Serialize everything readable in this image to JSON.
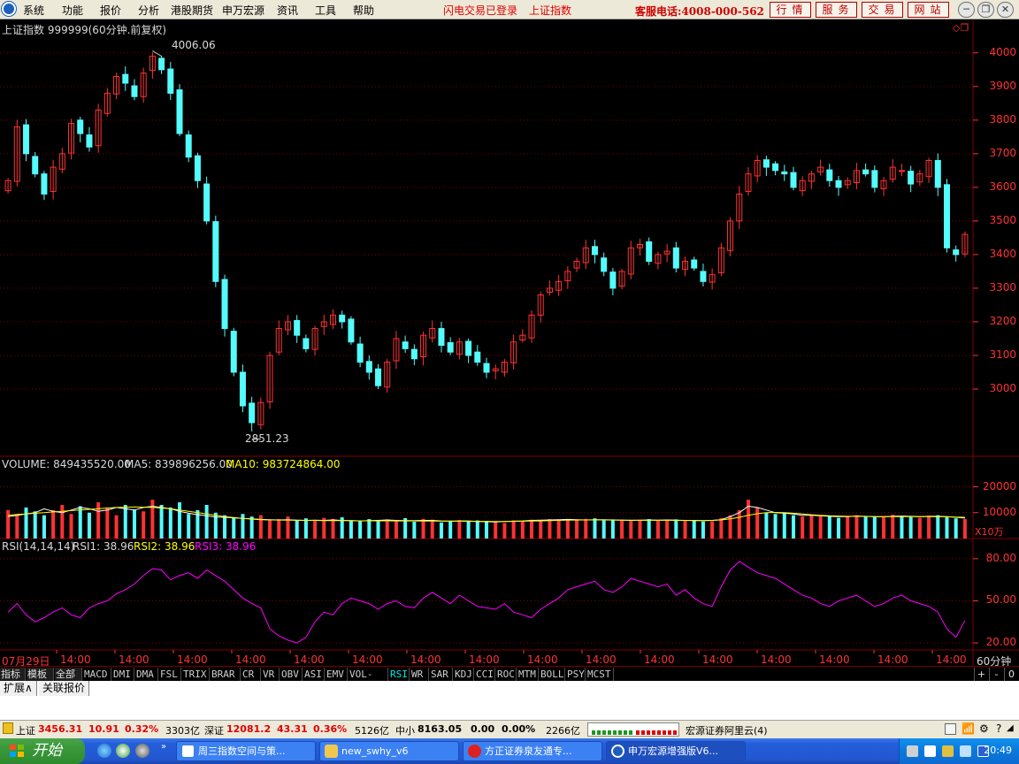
{
  "menubar": {
    "items": [
      "系统",
      "功能",
      "报价",
      "分析",
      "港股期货",
      "申万宏源",
      "资讯",
      "工具",
      "帮助"
    ],
    "notice_login": "闪电交易已登录",
    "notice_index": "上证指数",
    "service_phone": "客服电话:4008-000-562",
    "buttons": [
      "行情",
      "服务",
      "交易",
      "网站"
    ],
    "window_controls": [
      "minimize-icon",
      "restore-icon",
      "close-icon"
    ]
  },
  "chart": {
    "header": "上证指数 999999(60分钟.前复权)",
    "max_label": "4006.06",
    "min_label": "2851.23",
    "volume_header": {
      "volume": "VOLUME: 849435520.00",
      "ma5": "MA5: 839896256.00",
      "ma10": "MA10: 983724864.00"
    },
    "volume_unit": "X10万",
    "rsi_header": {
      "name": "RSI(14,14,14)",
      "rsi1": "RSI1: 38.96",
      "rsi2": "RSI2: 38.96",
      "rsi3": "RSI3: 38.96"
    },
    "date_start": "07月29日",
    "time_label": "14:00",
    "period": "60分钟",
    "colors": {
      "up": "#ff3232",
      "down": "#54fcfc",
      "ma5": "#ffffff",
      "ma10": "#ffff00",
      "rsi": "#ff00ff",
      "grid": "#800000"
    }
  },
  "chart_data": [
    {
      "type": "candlestick",
      "title": "上证指数 999999(60分钟.前复权)",
      "ylim": [
        2800,
        4060
      ],
      "yticks": [
        3000,
        3100,
        3200,
        3300,
        3400,
        3500,
        3600,
        3700,
        3800,
        3900,
        4000
      ],
      "annotations": [
        {
          "label": "4006.06",
          "value": 4006.06
        },
        {
          "label": "2851.23",
          "value": 2851.23
        }
      ],
      "series": [
        {
          "name": "close",
          "values": [
            3620,
            3780,
            3700,
            3640,
            3580,
            3660,
            3700,
            3790,
            3760,
            3720,
            3830,
            3880,
            3930,
            3910,
            3870,
            3940,
            3990,
            3950,
            3880,
            3760,
            3690,
            3620,
            3500,
            3320,
            3180,
            3050,
            2950,
            2900,
            2960,
            3100,
            3180,
            3200,
            3160,
            3120,
            3180,
            3200,
            3220,
            3200,
            3140,
            3080,
            3050,
            3010,
            3080,
            3150,
            3120,
            3090,
            3160,
            3180,
            3130,
            3110,
            3140,
            3100,
            3080,
            3050,
            3060,
            3080,
            3140,
            3160,
            3220,
            3280,
            3300,
            3320,
            3350,
            3380,
            3420,
            3400,
            3350,
            3300,
            3350,
            3420,
            3430,
            3380,
            3400,
            3410,
            3360,
            3380,
            3360,
            3320,
            3340,
            3420,
            3500,
            3580,
            3640,
            3680,
            3660,
            3650,
            3640,
            3600,
            3620,
            3640,
            3660,
            3620,
            3600,
            3620,
            3650,
            3640,
            3600,
            3620,
            3660,
            3650,
            3610,
            3640,
            3680,
            3600,
            3420,
            3400,
            3460
          ]
        }
      ]
    },
    {
      "type": "bar",
      "title": "VOLUME",
      "ylabel": "X10万",
      "yticks": [
        10000,
        20000
      ],
      "series": [
        {
          "name": "VOLUME",
          "values": [
            11000,
            9000,
            12000,
            10500,
            9000,
            11000,
            13000,
            9500,
            12500,
            10000,
            14000,
            12000,
            9000,
            13000,
            11000,
            10500,
            15000,
            13000,
            12000,
            14000,
            9500,
            11000,
            13000,
            10000,
            9000,
            8000,
            9500,
            8500,
            9000,
            7000,
            7500,
            8500,
            7000,
            7800,
            7200,
            8000,
            7600,
            8200,
            7000,
            6800,
            7500,
            7200,
            7400,
            7000,
            7900,
            6500,
            7600,
            7300,
            6200,
            6900,
            7100,
            6600,
            7000,
            6800,
            6400,
            6000,
            7000,
            6600,
            7300,
            6900,
            7500,
            7000,
            7200,
            7300,
            7600,
            7800,
            7000,
            7400,
            7300,
            7100,
            7200,
            7500,
            7000,
            7300,
            7400,
            7100,
            7000,
            6600,
            6700,
            7900,
            9000,
            11000,
            15000,
            12000,
            10000,
            9500,
            9800,
            9000,
            8500,
            9000,
            8600,
            8800,
            8000,
            8500,
            9000,
            8700,
            8400,
            8200,
            9200,
            8600,
            8300,
            8000,
            8800,
            9000,
            8200,
            7800,
            7500
          ]
        },
        {
          "name": "MA5",
          "values": [
            8500,
            9000,
            9500,
            10000,
            11500,
            10500,
            10000,
            11000,
            12000,
            11500,
            10500,
            11000,
            12000,
            11500,
            11000,
            12000,
            12500,
            12000,
            11500,
            10500,
            9800,
            9200,
            8800,
            8300,
            8200,
            8000,
            7800,
            7600,
            7400,
            7300,
            7200,
            7300,
            7100,
            7000,
            7100,
            7000,
            7200,
            7000,
            6900,
            6800,
            6900,
            7000,
            7200,
            7000,
            6900,
            6900,
            7000,
            7000,
            6800,
            6700,
            6800,
            6800,
            6600,
            6500,
            6400,
            6600,
            6700,
            6800,
            7000,
            7100,
            7200,
            7300,
            7400,
            7300,
            7200,
            7300,
            7300,
            7200,
            7100,
            7000,
            7100,
            7200,
            7100,
            7200,
            7100,
            7000,
            6900,
            6900,
            7000,
            7300,
            8500,
            10000,
            12500,
            12000,
            11000,
            10000,
            9800,
            9500,
            9000,
            9000,
            8800,
            8600,
            8500,
            8500,
            8700,
            8600,
            8500,
            8400,
            8600,
            8700,
            8600,
            8500,
            8600,
            8600,
            8500,
            8200,
            7900
          ]
        },
        {
          "name": "MA10",
          "values": [
            9000,
            9300,
            9500,
            9800,
            10000,
            10300,
            10500,
            10800,
            11000,
            11300,
            11500,
            11800,
            12000,
            12100,
            12200,
            12100,
            12000,
            11800,
            11500,
            11000,
            10500,
            10000,
            9500,
            9000,
            8500,
            8100,
            7800,
            7500,
            7300,
            7200,
            7150,
            7100,
            7050,
            7000,
            7000,
            6950,
            6950,
            6900,
            6900,
            6850,
            6850,
            6850,
            6850,
            6800,
            6800,
            6800,
            6750,
            6750,
            6700,
            6700,
            6700,
            6650,
            6650,
            6650,
            6600,
            6600,
            6650,
            6700,
            6750,
            6800,
            6900,
            7000,
            7100,
            7150,
            7200,
            7200,
            7200,
            7150,
            7100,
            7100,
            7050,
            7050,
            7050,
            7050,
            7000,
            7000,
            7000,
            6950,
            7000,
            7200,
            7600,
            8200,
            9000,
            9600,
            10000,
            10100,
            10000,
            9800,
            9500,
            9200,
            9000,
            8800,
            8700,
            8600,
            8600,
            8550,
            8500,
            8500,
            8500,
            8500,
            8500,
            8450,
            8450,
            8400,
            8400,
            8300,
            8200
          ]
        }
      ]
    },
    {
      "type": "line",
      "title": "RSI(14,14,14)",
      "ylim": [
        15,
        90
      ],
      "yticks": [
        20,
        50,
        80
      ],
      "series": [
        {
          "name": "RSI1",
          "values": [
            42,
            48,
            40,
            35,
            38,
            42,
            45,
            40,
            38,
            45,
            48,
            50,
            55,
            58,
            62,
            68,
            73,
            72,
            65,
            68,
            70,
            66,
            72,
            68,
            64,
            58,
            52,
            48,
            45,
            30,
            25,
            22,
            20,
            24,
            35,
            42,
            40,
            48,
            52,
            50,
            48,
            44,
            48,
            50,
            46,
            45,
            52,
            56,
            52,
            48,
            54,
            50,
            46,
            45,
            44,
            48,
            42,
            40,
            38,
            44,
            48,
            52,
            58,
            60,
            62,
            64,
            58,
            56,
            60,
            66,
            64,
            62,
            60,
            62,
            54,
            58,
            52,
            48,
            46,
            60,
            72,
            78,
            74,
            70,
            68,
            66,
            62,
            58,
            54,
            52,
            48,
            46,
            50,
            52,
            54,
            50,
            46,
            48,
            52,
            54,
            50,
            48,
            46,
            42,
            30,
            24,
            36
          ]
        }
      ]
    }
  ],
  "tabs": {
    "items": [
      "指标",
      "模板",
      "全部",
      "MACD",
      "DMI",
      "DMA",
      "FSL",
      "TRIX",
      "BRAR",
      "CR",
      "VR",
      "OBV",
      "ASI",
      "EMV",
      "VOL-TDX",
      "RSI",
      "WR",
      "SAR",
      "KDJ",
      "CCI",
      "ROC",
      "MTM",
      "BOLL",
      "PSY",
      "MCST"
    ],
    "controls": [
      "+",
      "-",
      "0"
    ]
  },
  "panel": {
    "tabs": [
      "扩展∧",
      "关联报价"
    ]
  },
  "status": {
    "sh_label": "上证",
    "sh_value": "3456.31",
    "sh_change": "10.91",
    "sh_pct": "0.32%",
    "sh_amount": "3303亿",
    "sz_label": "深证",
    "sz_value": "12081.2",
    "sz_change": "43.31",
    "sz_pct": "0.36%",
    "sz_amount": "5126亿",
    "zx_label": "中小",
    "zx_value": "8163.05",
    "zx_change": "0.00",
    "zx_pct": "0.00%",
    "zx_amount": "2266亿",
    "broker": "宏源证券阿里云(4)"
  },
  "taskbar": {
    "start": "开始",
    "tasks": [
      "周三指数空间与策...",
      "new_swhy_v6",
      "方正证券泉友通专...",
      "申万宏源增强版V6..."
    ],
    "clock": "20:49"
  }
}
